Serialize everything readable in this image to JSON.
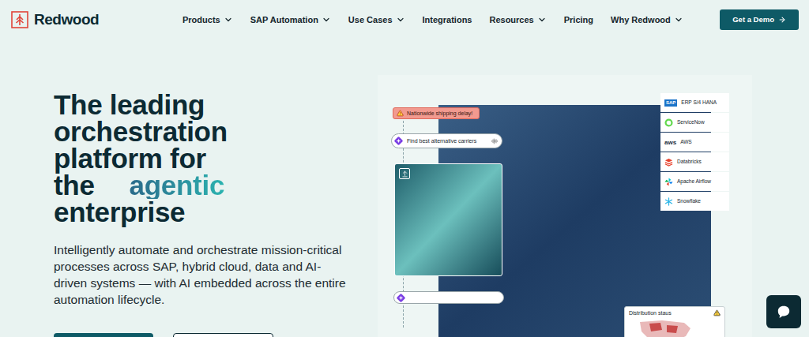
{
  "header": {
    "logo": "Redwood",
    "nav": [
      {
        "label": "Products",
        "dropdown": true
      },
      {
        "label": "SAP Automation",
        "dropdown": true
      },
      {
        "label": "Use Cases",
        "dropdown": true
      },
      {
        "label": "Integrations",
        "dropdown": false
      },
      {
        "label": "Resources",
        "dropdown": true
      },
      {
        "label": "Pricing",
        "dropdown": false
      },
      {
        "label": "Why Redwood",
        "dropdown": true
      }
    ],
    "cta": "Get a Demo"
  },
  "hero": {
    "title_lines": [
      [
        {
          "text": "The leading",
          "highlight": false
        }
      ],
      [
        {
          "text": "orchestration",
          "highlight": false
        }
      ],
      [
        {
          "text": "platform for",
          "highlight": false
        }
      ],
      [
        {
          "text": "the",
          "highlight": false
        },
        {
          "text": "agentic",
          "highlight": true
        }
      ],
      [
        {
          "text": "enterprise",
          "highlight": false
        }
      ]
    ],
    "subtitle": "Intelligently automate and orchestrate mission-critical processes across SAP, hybrid cloud, data and AI-driven systems — with AI embedded across the entire automation lifecycle.",
    "buttons": [
      {
        "kind": "primary"
      },
      {
        "kind": "secondary"
      }
    ]
  },
  "visual": {
    "alert": "Nationwide shipping delay!",
    "prompt": "Find best alternative carriers",
    "integrations": [
      {
        "name": "ERP S/4 HANA",
        "mark": "SAP",
        "kind": "badge",
        "color": "#1a73c8"
      },
      {
        "name": "ServiceNow",
        "mark": "",
        "kind": "ring",
        "color": "#62d84e"
      },
      {
        "name": "AWS",
        "mark": "aws",
        "kind": "wordmark",
        "color": "#232f3e"
      },
      {
        "name": "Databricks",
        "mark": "",
        "kind": "layers",
        "color": "#e8412c"
      },
      {
        "name": "Apache Airflow",
        "mark": "",
        "kind": "pinwheel",
        "color": "#017cee"
      },
      {
        "name": "Snowflake",
        "mark": "",
        "kind": "flake",
        "color": "#29b5e8"
      }
    ],
    "status_card": {
      "title": "Distribution staus"
    }
  }
}
